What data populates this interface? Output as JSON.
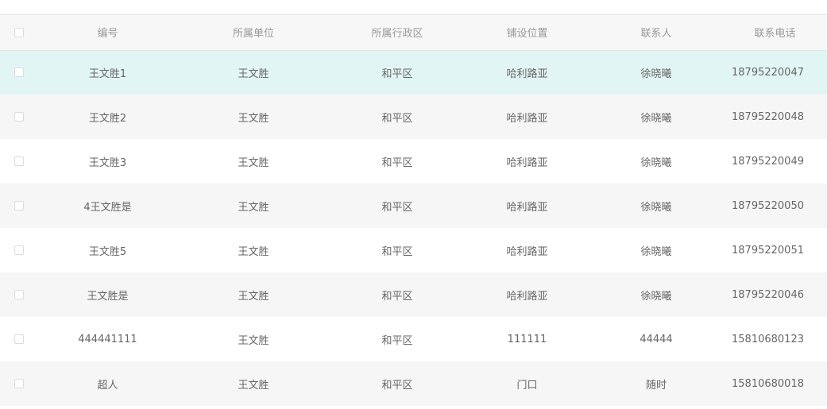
{
  "table": {
    "columns": [
      "编号",
      "所属单位",
      "所属行政区",
      "铺设位置",
      "联系人",
      "联系电话"
    ],
    "rows": [
      {
        "id": "王文胜1",
        "unit": "王文胜",
        "district": "和平区",
        "location": "哈利路亚",
        "contact": "徐晓曦",
        "phone": "18795220047",
        "highlighted": true
      },
      {
        "id": "王文胜2",
        "unit": "王文胜",
        "district": "和平区",
        "location": "哈利路亚",
        "contact": "徐晓曦",
        "phone": "18795220048"
      },
      {
        "id": "王文胜3",
        "unit": "王文胜",
        "district": "和平区",
        "location": "哈利路亚",
        "contact": "徐晓曦",
        "phone": "18795220049"
      },
      {
        "id": "4王文胜是",
        "unit": "王文胜",
        "district": "和平区",
        "location": "哈利路亚",
        "contact": "徐晓曦",
        "phone": "18795220050"
      },
      {
        "id": "王文胜5",
        "unit": "王文胜",
        "district": "和平区",
        "location": "哈利路亚",
        "contact": "徐晓曦",
        "phone": "18795220051"
      },
      {
        "id": "王文胜是",
        "unit": "王文胜",
        "district": "和平区",
        "location": "哈利路亚",
        "contact": "徐晓曦",
        "phone": "18795220046"
      },
      {
        "id": "444441111",
        "unit": "王文胜",
        "district": "和平区",
        "location": "111111",
        "contact": "44444",
        "phone": "15810680123"
      },
      {
        "id": "超人",
        "unit": "王文胜",
        "district": "和平区",
        "location": "门口",
        "contact": "随时",
        "phone": "15810680018"
      }
    ]
  },
  "colors": {
    "highlight_row": "#e1f6f4",
    "striped_row": "#f6f6f6",
    "header_bg": "#f7f7f7",
    "header_text": "#999999",
    "cell_text": "#666666"
  }
}
